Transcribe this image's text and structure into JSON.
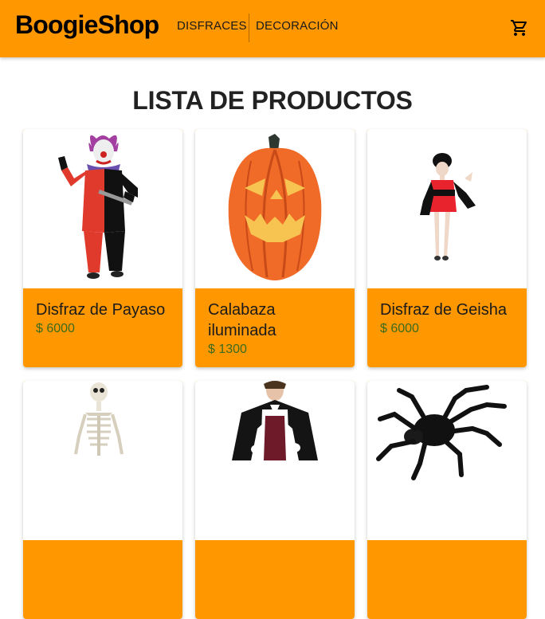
{
  "header": {
    "logo": "BoogieShop",
    "nav": [
      "DISFRACES",
      "DECORACIÓN"
    ],
    "cart_icon": "shopping-cart-icon"
  },
  "main": {
    "title": "LISTA DE PRODUCTOS",
    "products": [
      {
        "name": "Disfraz de Payaso",
        "price": "$ 6000",
        "image": "clown-costume-image"
      },
      {
        "name": "Calabaza iluminada",
        "price": "$ 1300",
        "image": "pumpkin-image"
      },
      {
        "name": "Disfraz de Geisha",
        "price": "$ 6000",
        "image": "geisha-costume-image"
      },
      {
        "name": "",
        "price": "",
        "image": "skeleton-image"
      },
      {
        "name": "",
        "price": "",
        "image": "vampire-costume-image"
      },
      {
        "name": "",
        "price": "",
        "image": "spider-image"
      }
    ]
  },
  "colors": {
    "accent": "#ff9800",
    "price": "#3b6b1f"
  }
}
